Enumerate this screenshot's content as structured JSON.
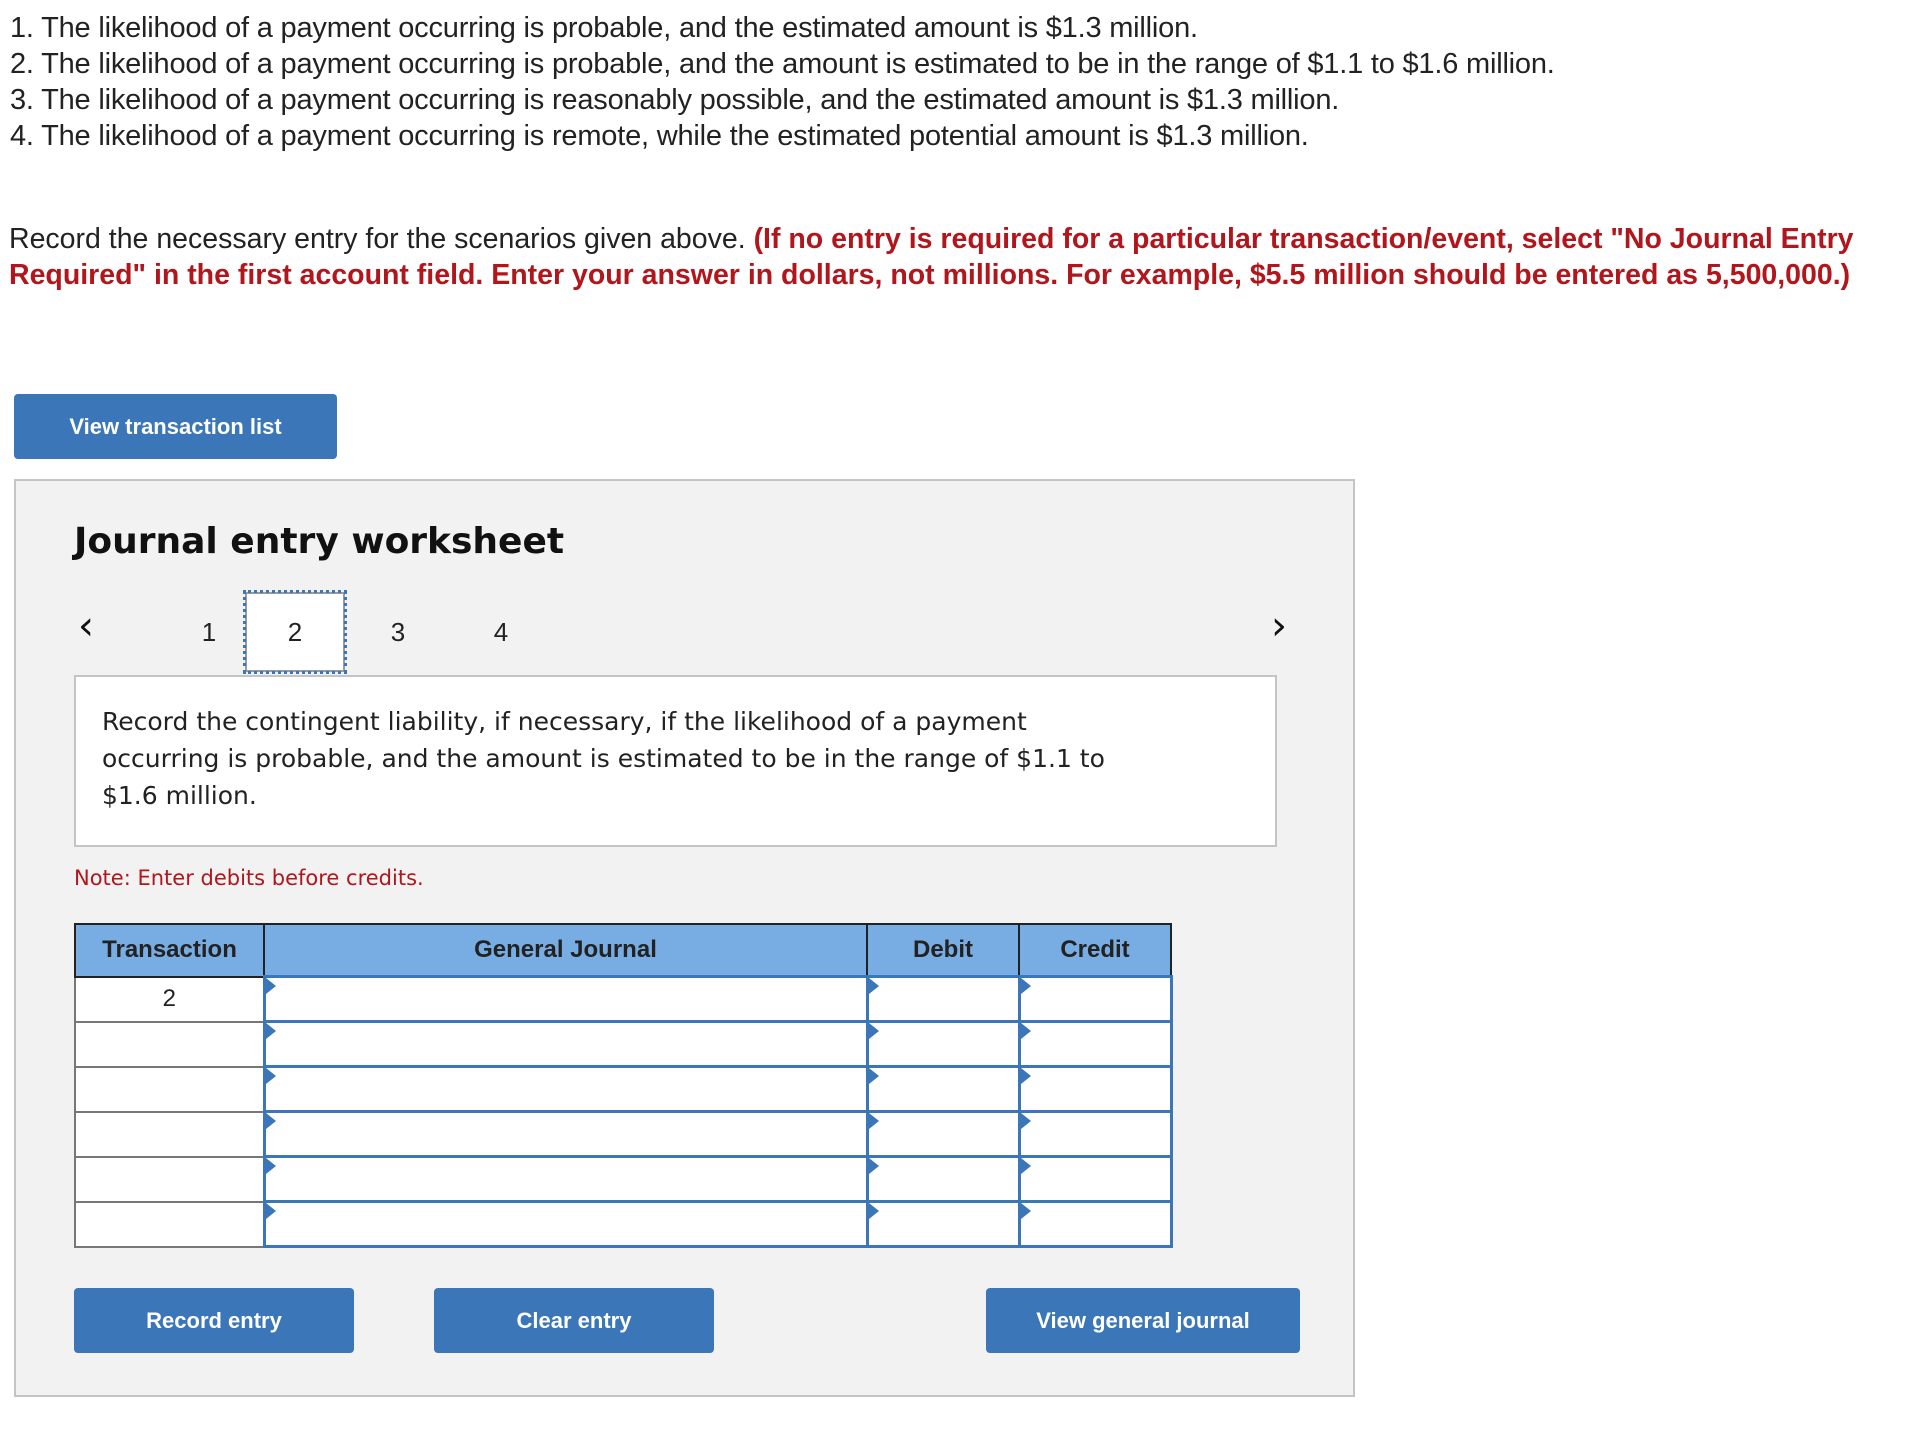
{
  "scenarios": [
    "1. The likelihood of a payment occurring is probable, and the estimated amount is $1.3 million.",
    "2. The likelihood of a payment occurring is probable, and the amount is estimated to be in the range of $1.1 to $1.6 million.",
    "3. The likelihood of a payment occurring is reasonably possible, and the estimated amount is $1.3 million.",
    "4. The likelihood of a payment occurring is remote, while the estimated potential amount is $1.3 million."
  ],
  "instructions": {
    "plain": "Record the necessary entry for the scenarios given above. ",
    "emphasis": "(If no entry is required for a particular transaction/event, select \"No Journal Entry Required\" in the first account field. Enter your answer in dollars, not millions. For example, $5.5 million should be entered as 5,500,000.)"
  },
  "buttons": {
    "view_transaction_list": "View transaction list",
    "record_entry": "Record entry",
    "clear_entry": "Clear entry",
    "view_general_journal": "View general journal"
  },
  "worksheet": {
    "title": "Journal entry worksheet",
    "prev_icon": "‹",
    "next_icon": "›",
    "tabs": [
      "1",
      "2",
      "3",
      "4"
    ],
    "active_tab": "2",
    "description": "Record the contingent liability, if necessary, if the likelihood of a payment occurring is probable, and the amount is estimated to be in the range of $1.1 to $1.6 million.",
    "note": "Note: Enter debits before credits.",
    "table": {
      "headers": [
        "Transaction",
        "General Journal",
        "Debit",
        "Credit"
      ],
      "rows": [
        {
          "transaction": "2",
          "account": "",
          "debit": "",
          "credit": ""
        },
        {
          "transaction": "",
          "account": "",
          "debit": "",
          "credit": ""
        },
        {
          "transaction": "",
          "account": "",
          "debit": "",
          "credit": ""
        },
        {
          "transaction": "",
          "account": "",
          "debit": "",
          "credit": ""
        },
        {
          "transaction": "",
          "account": "",
          "debit": "",
          "credit": ""
        },
        {
          "transaction": "",
          "account": "",
          "debit": "",
          "credit": ""
        }
      ]
    }
  },
  "colors": {
    "accent": "#3a76b8",
    "header_bg": "#78ade4",
    "warning_red": "#b1161c",
    "panel_bg": "#f2f2f2"
  }
}
